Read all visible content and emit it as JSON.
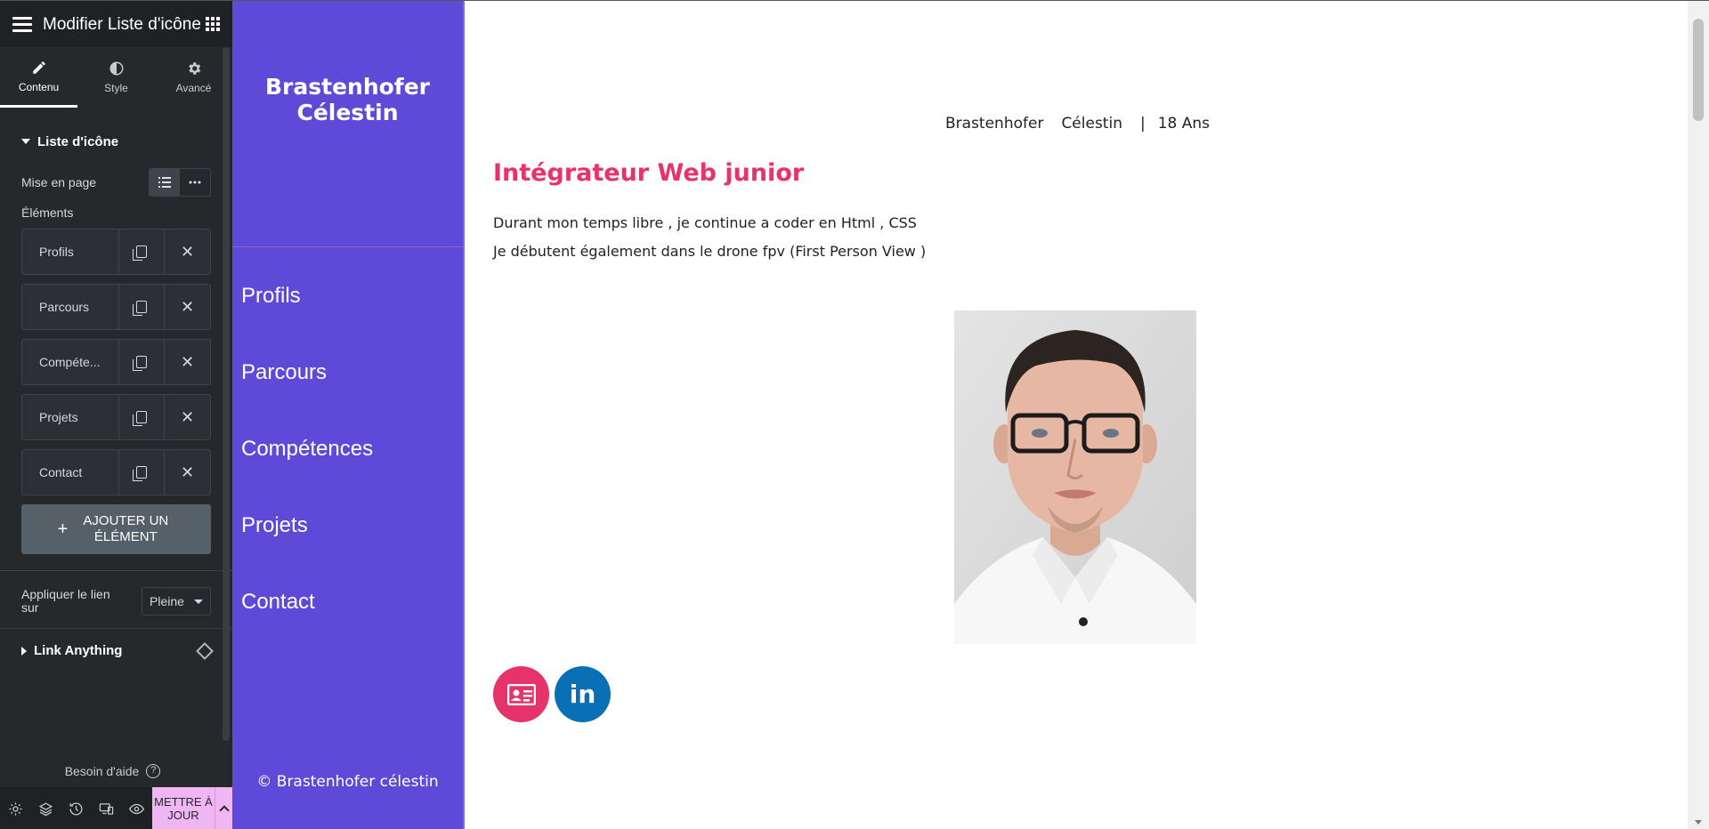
{
  "panel": {
    "title": "Modifier Liste d'icône",
    "tabs": [
      {
        "label": "Contenu",
        "icon": "pencil-icon"
      },
      {
        "label": "Style",
        "icon": "contrast-icon"
      },
      {
        "label": "Avancé",
        "icon": "gear-icon"
      }
    ],
    "section_title": "Liste d'icône",
    "layout_label": "Mise en page",
    "elements_label": "Éléments",
    "items": [
      "Profils",
      "Parcours",
      "Compéte...",
      "Projets",
      "Contact"
    ],
    "add_button": "AJOUTER UN ÉLÉMENT",
    "apply_link_label": "Appliquer le lien sur",
    "apply_link_value": "Pleine",
    "link_anything": "Link Anything",
    "help": "Besoin d'aide",
    "update_button": "METTRE À JOUR"
  },
  "site": {
    "name": "Brastenhofer Célestin",
    "nav": [
      "Profils",
      "Parcours",
      "Compétences",
      "Projets",
      "Contact"
    ],
    "copyright": "© Brastenhofer célestin",
    "meta": {
      "last_name": "Brastenhofer",
      "first_name": "Célestin",
      "separator": "|",
      "age": "18 Ans"
    },
    "job_title": "Intégrateur Web junior",
    "description": [
      "Durant mon temps libre , je continue a coder en Html , CSS",
      "Je débutent également dans le drone fpv (First Person View )"
    ],
    "social": {
      "linkedin": "in"
    }
  },
  "colors": {
    "panel_bg": "#26292c",
    "sidebar_bg": "#5f49d8",
    "accent_pink": "#e6336a",
    "linkedin_blue": "#0a70b6",
    "update_bg": "#f0b6f3"
  }
}
